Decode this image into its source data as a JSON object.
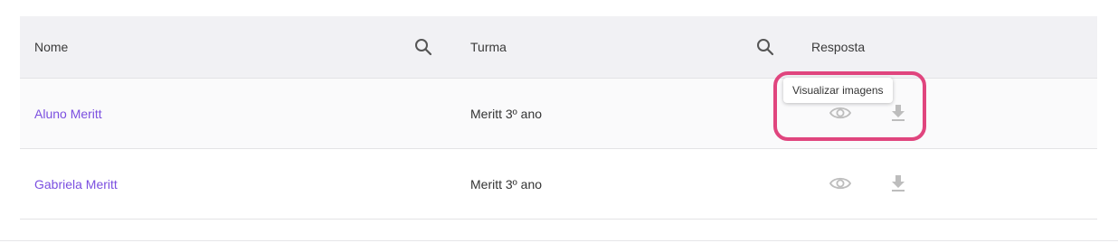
{
  "table": {
    "headers": {
      "name": "Nome",
      "turma": "Turma",
      "resposta": "Resposta"
    },
    "rows": [
      {
        "name": "Aluno Meritt",
        "turma": "Meritt 3º ano"
      },
      {
        "name": "Gabriela Meritt",
        "turma": "Meritt 3º ano"
      }
    ]
  },
  "tooltip": {
    "text": "Visualizar imagens"
  },
  "icons": {
    "search": "search-icon",
    "view": "eye-icon",
    "download": "download-icon"
  },
  "colors": {
    "header_bg": "#f1f1f4",
    "link": "#7b4fe0",
    "icon": "#bdbdbd",
    "highlight": "#e0457e"
  }
}
